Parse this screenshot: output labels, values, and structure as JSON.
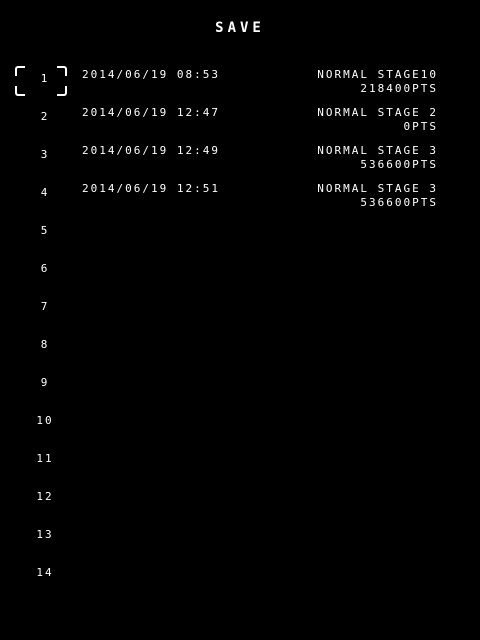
{
  "screen": {
    "title": "SAVE",
    "selected_slot": 1
  },
  "slots": [
    {
      "number": "1",
      "date": "2014/06/19 08:53",
      "mode": "NORMAL STAGE10",
      "score": "218400PTS"
    },
    {
      "number": "2",
      "date": "2014/06/19 12:47",
      "mode": "NORMAL STAGE 2",
      "score": "0PTS"
    },
    {
      "number": "3",
      "date": "2014/06/19 12:49",
      "mode": "NORMAL STAGE 3",
      "score": "536600PTS"
    },
    {
      "number": "4",
      "date": "2014/06/19 12:51",
      "mode": "NORMAL STAGE 3",
      "score": "536600PTS"
    },
    {
      "number": "5"
    },
    {
      "number": "6"
    },
    {
      "number": "7"
    },
    {
      "number": "8"
    },
    {
      "number": "9"
    },
    {
      "number": "10"
    },
    {
      "number": "11"
    },
    {
      "number": "12"
    },
    {
      "number": "13"
    },
    {
      "number": "14"
    }
  ],
  "colors": {
    "background": "#000000",
    "text": "#ffffff"
  }
}
